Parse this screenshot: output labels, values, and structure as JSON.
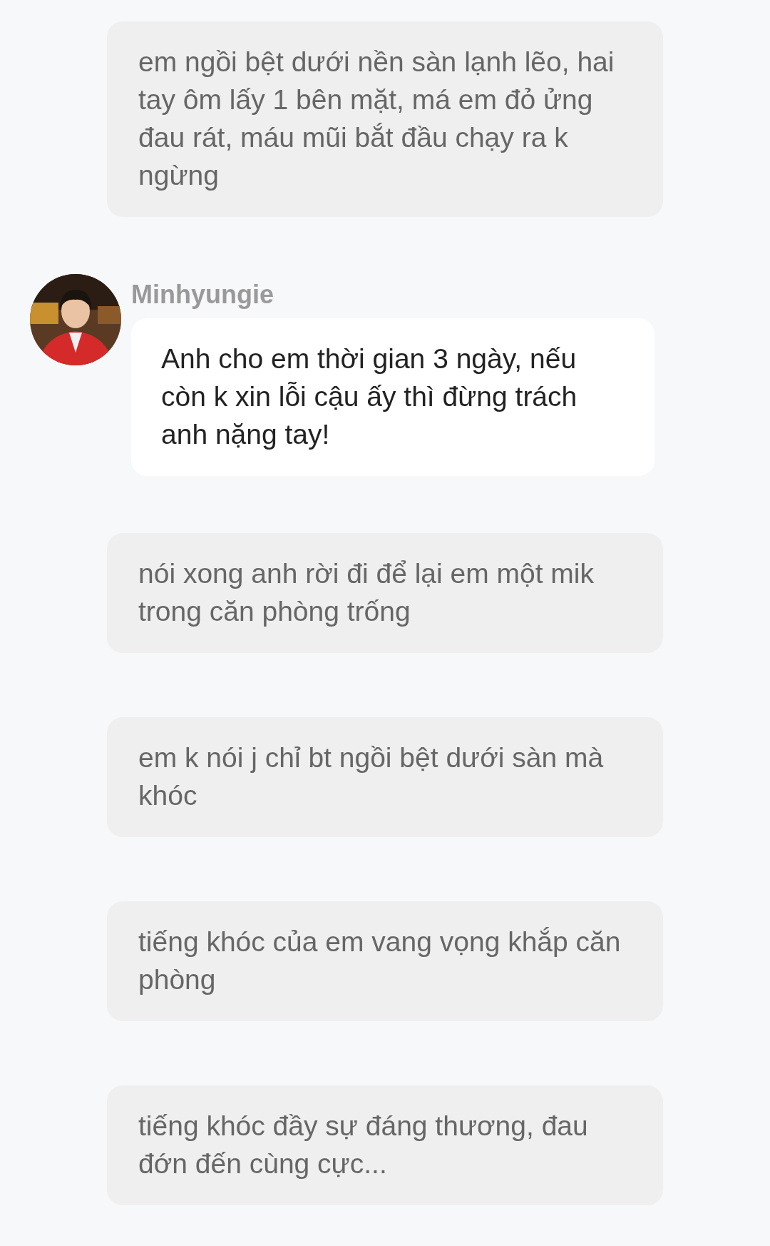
{
  "messages": [
    {
      "kind": "narration",
      "text": "em ngồi bệt dưới nền sàn lạnh lẽo, hai tay ôm lấy 1 bên mặt, má em đỏ ửng đau rát, máu mũi bắt đầu chạy ra k ngừng"
    },
    {
      "kind": "message",
      "sender": "Minhyungie",
      "text": "Anh cho em thời gian 3 ngày, nếu còn k xin lỗi cậu ấy thì đừng trách anh nặng tay!"
    },
    {
      "kind": "narration",
      "text": "nói xong anh rời đi để lại em một mik trong căn phòng trống"
    },
    {
      "kind": "narration",
      "text": "em k nói j chỉ bt ngồi bệt dưới sàn mà khóc"
    },
    {
      "kind": "narration",
      "text": "tiếng khóc của em vang vọng khắp căn phòng"
    },
    {
      "kind": "narration",
      "text": "tiếng khóc đầy sự đáng thương, đau đớn đến cùng cực..."
    }
  ]
}
